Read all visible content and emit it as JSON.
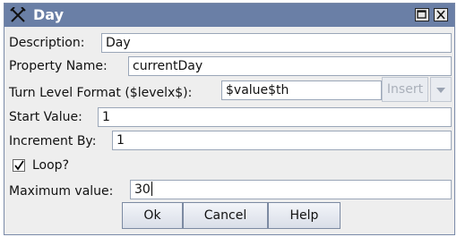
{
  "window": {
    "title": "Day",
    "icon": "crossed-tools-icon",
    "maximize_icon": "maximize-icon",
    "close_icon": "close-icon"
  },
  "form": {
    "description": {
      "label": "Description:",
      "value": "Day"
    },
    "property_name": {
      "label": "Property Name:",
      "value": "currentDay"
    },
    "turn_level_format": {
      "label": "Turn Level Format ($levelx$):",
      "value": "$value$th",
      "insert_label": "Insert"
    },
    "start_value": {
      "label": "Start Value:",
      "value": "1"
    },
    "increment_by": {
      "label": "Increment By:",
      "value": "1"
    },
    "loop": {
      "label": "Loop?",
      "checked": true
    },
    "maximum_value": {
      "label": "Maximum value:",
      "value": "30"
    }
  },
  "buttons": {
    "ok": "Ok",
    "cancel": "Cancel",
    "help": "Help"
  }
}
